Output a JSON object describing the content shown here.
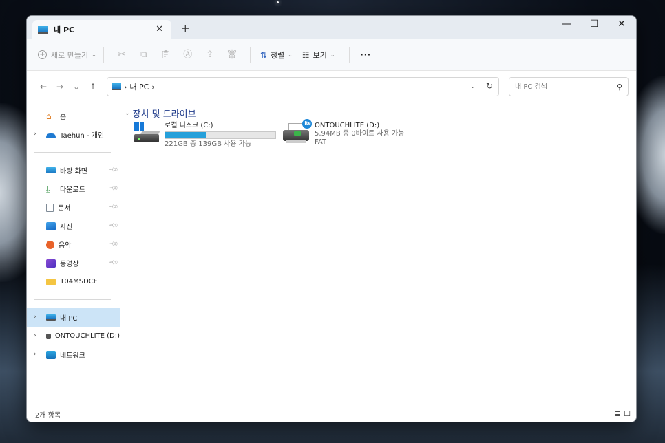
{
  "tab": {
    "title": "내 PC",
    "close": "✕",
    "new_tab": "+"
  },
  "window_controls": {
    "minimize": "—",
    "maximize": "☐",
    "close": "✕"
  },
  "toolbar": {
    "new_label": "새로 만들기",
    "sort_label": "정렬",
    "view_label": "보기",
    "more_label": "···"
  },
  "address": {
    "crumb": "내 PC",
    "separator": "›",
    "search_placeholder": "내 PC 검색"
  },
  "sidebar": {
    "items": [
      {
        "label": "홈",
        "icon": "home-icon"
      },
      {
        "label": "Taehun - 개인",
        "icon": "cloud-icon"
      },
      {
        "label": "바탕 화면",
        "icon": "desktop-icon",
        "pinned": true
      },
      {
        "label": "다운로드",
        "icon": "download-icon",
        "pinned": true
      },
      {
        "label": "문서",
        "icon": "document-icon",
        "pinned": true
      },
      {
        "label": "사진",
        "icon": "pictures-icon",
        "pinned": true
      },
      {
        "label": "음악",
        "icon": "music-icon",
        "pinned": true
      },
      {
        "label": "동영상",
        "icon": "video-icon",
        "pinned": true
      },
      {
        "label": "104MSDCF",
        "icon": "folder-icon"
      },
      {
        "label": "내 PC",
        "icon": "pc-icon",
        "selected": true
      },
      {
        "label": "ONTOUCHLITE (D:)",
        "icon": "printer-drive-icon"
      },
      {
        "label": "네트워크",
        "icon": "network-icon"
      }
    ]
  },
  "main": {
    "group_header": "장치 및 드라이브",
    "drives": [
      {
        "name": "로컬 디스크 (C:)",
        "space": "221GB 중 139GB 사용 가능",
        "used_fraction": 0.37,
        "fs": ""
      },
      {
        "name": "ONTOUCHLITE (D:)",
        "space": "5.94MB 중 0바이트 사용 가능",
        "fs": "FAT"
      }
    ]
  },
  "status": {
    "count": "2개 항목"
  },
  "colors": {
    "accent": "#26a0da",
    "selected_bg": "#cce4f7",
    "window_bg": "#ffffff",
    "toolbar_bg": "#f7f9fb"
  }
}
